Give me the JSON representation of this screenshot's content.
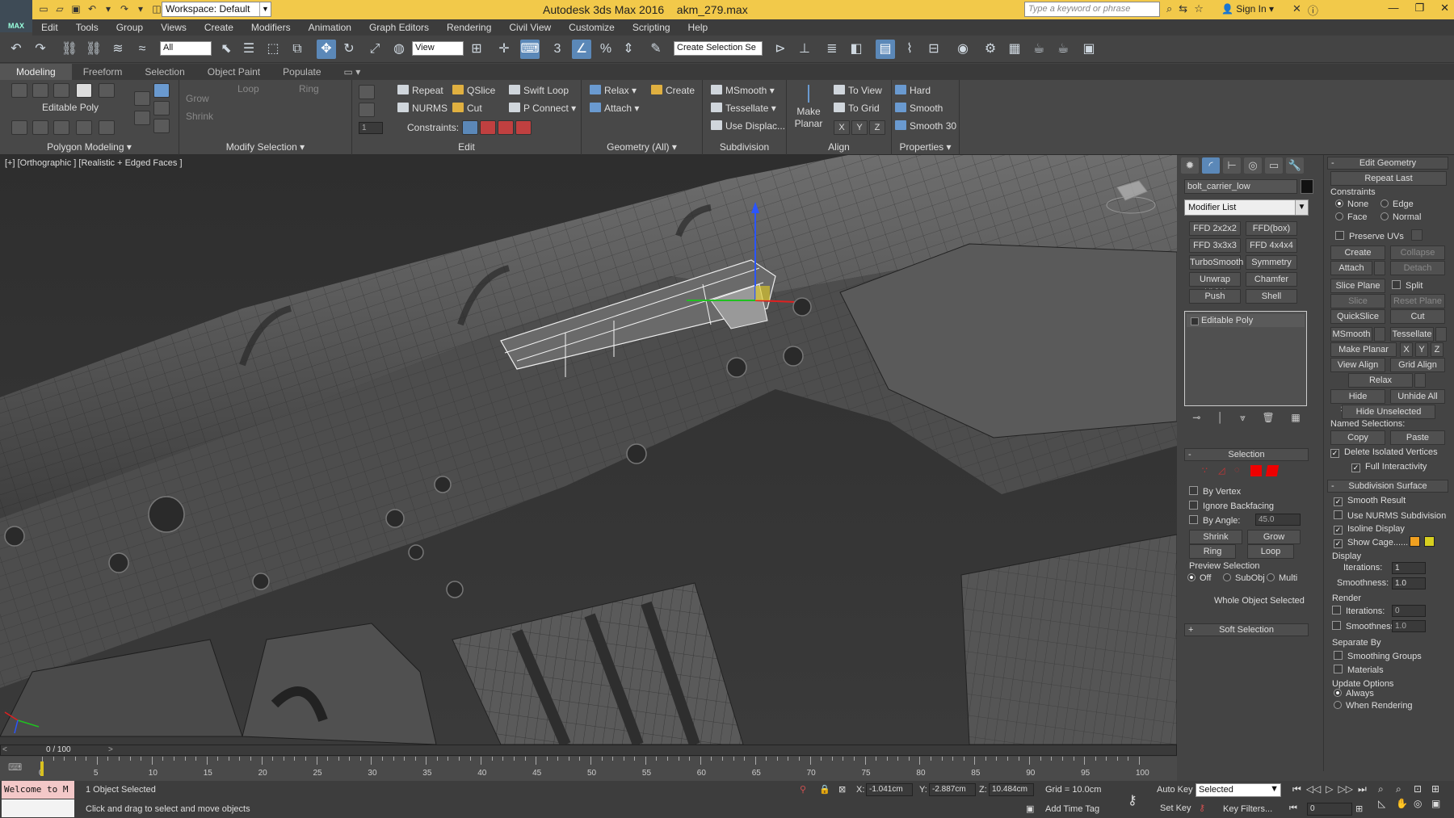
{
  "app": {
    "logo": "MAX",
    "workspace": "Workspace: Default",
    "title": "Autodesk 3ds Max 2016",
    "filename": "akm_279.max",
    "search_placeholder": "Type a keyword or phrase",
    "signin": "Sign In"
  },
  "menu": [
    "Edit",
    "Tools",
    "Group",
    "Views",
    "Create",
    "Modifiers",
    "Animation",
    "Graph Editors",
    "Rendering",
    "Civil View",
    "Customize",
    "Scripting",
    "Help"
  ],
  "toolbar": {
    "filter": "All",
    "refcoord": "View",
    "named_sel": "Create Selection Se"
  },
  "ribbon": {
    "tabs": [
      "Modeling",
      "Freeform",
      "Selection",
      "Object Paint",
      "Populate"
    ],
    "groups": {
      "polygon": "Polygon Modeling",
      "modify_sel": "Modify Selection",
      "edit": "Edit",
      "geometry": "Geometry (All)",
      "subdivision": "Subdivision",
      "align": "Align",
      "properties": "Properties"
    },
    "editable_poly": "Editable Poly",
    "grow": "Grow",
    "shrink": "Shrink",
    "loop": "Loop",
    "ring": "Ring",
    "repeat": "Repeat",
    "qslice": "QSlice",
    "swift_loop": "Swift Loop",
    "nurms": "NURMS",
    "cut": "Cut",
    "p_connect": "P Connect",
    "constraints": "Constraints:",
    "relax": "Relax",
    "create": "Create",
    "attach": "Attach",
    "msmooth": "MSmooth",
    "tessellate": "Tessellate",
    "use_displac": "Use Displac...",
    "make_planar": "Make Planar",
    "to_view": "To View",
    "to_grid": "To Grid",
    "x": "X",
    "y": "Y",
    "z": "Z",
    "hard": "Hard",
    "smooth": "Smooth",
    "smooth30": "Smooth 30",
    "spin_val": "1"
  },
  "viewport": {
    "label": "[+] [Orthographic ] [Realistic + Edged Faces ]",
    "cube": "LEFT"
  },
  "cmd": {
    "object_name": "bolt_carrier_low",
    "modifier_list": "Modifier List",
    "mod_buttons": [
      "FFD 2x2x2",
      "FFD(box)",
      "FFD 3x3x3",
      "FFD 4x4x4",
      "TurboSmooth",
      "Symmetry",
      "Unwrap UVW",
      "Chamfer",
      "Push",
      "Shell"
    ],
    "stack_item": "Editable Poly",
    "selection": {
      "title": "Selection",
      "by_vertex": "By Vertex",
      "ignore_backfacing": "Ignore Backfacing",
      "by_angle": "By Angle:",
      "angle": "45.0",
      "shrink": "Shrink",
      "grow": "Grow",
      "ring": "Ring",
      "loop": "Loop",
      "preview": "Preview Selection",
      "off": "Off",
      "subobj": "SubObj",
      "multi": "Multi",
      "status": "Whole Object Selected"
    },
    "soft_selection": "Soft Selection"
  },
  "editgeom": {
    "title": "Edit Geometry",
    "repeat_last": "Repeat Last",
    "constraints": "Constraints",
    "none": "None",
    "edge": "Edge",
    "face": "Face",
    "normal": "Normal",
    "preserve_uvs": "Preserve UVs",
    "create": "Create",
    "collapse": "Collapse",
    "attach": "Attach",
    "detach": "Detach",
    "slice_plane": "Slice Plane",
    "split": "Split",
    "slice": "Slice",
    "reset_plane": "Reset Plane",
    "quickslice": "QuickSlice",
    "cut": "Cut",
    "msmooth": "MSmooth",
    "tessellate": "Tessellate",
    "make_planar": "Make Planar",
    "x": "X",
    "y": "Y",
    "z": "Z",
    "view_align": "View Align",
    "grid_align": "Grid Align",
    "relax": "Relax",
    "hide_selected": "Hide Selected",
    "unhide_all": "Unhide All",
    "hide_unselected": "Hide Unselected",
    "named_selections": "Named Selections:",
    "copy": "Copy",
    "paste": "Paste",
    "delete_isolated": "Delete Isolated Vertices",
    "full_interactivity": "Full Interactivity",
    "subdiv_title": "Subdivision Surface",
    "smooth_result": "Smooth Result",
    "use_nurms": "Use NURMS Subdivision",
    "isoline": "Isoline Display",
    "show_cage": "Show Cage......",
    "display": "Display",
    "iterations": "Iterations:",
    "iter_val": "1",
    "smoothness": "Smoothness:",
    "smooth_val": "1.0",
    "render": "Render",
    "r_iter_val": "0",
    "r_smooth_val": "1.0",
    "separate_by": "Separate By",
    "smoothing_groups": "Smoothing Groups",
    "materials": "Materials",
    "update_options": "Update Options",
    "always": "Always",
    "when_rendering": "When Rendering",
    "cage_color1": "#f0a020",
    "cage_color2": "#d8d020"
  },
  "timeline": {
    "frame": "0 / 100",
    "ticks": [
      "0",
      "5",
      "10",
      "15",
      "20",
      "25",
      "30",
      "35",
      "40",
      "45",
      "50",
      "55",
      "60",
      "65",
      "70",
      "75",
      "80",
      "85",
      "90",
      "95",
      "100"
    ]
  },
  "status": {
    "welcome": "Welcome to M",
    "selected": "1 Object Selected",
    "prompt": "Click and drag to select and move objects",
    "x_label": "X:",
    "x": "-1.041cm",
    "y_label": "Y:",
    "y": "-2.887cm",
    "z_label": "Z:",
    "z": "10.484cm",
    "grid": "Grid = 10.0cm",
    "add_time_tag": "Add Time Tag",
    "auto_key": "Auto Key",
    "set_key": "Set Key",
    "selected_dd": "Selected",
    "key_filters": "Key Filters...",
    "frame_val": "0"
  }
}
